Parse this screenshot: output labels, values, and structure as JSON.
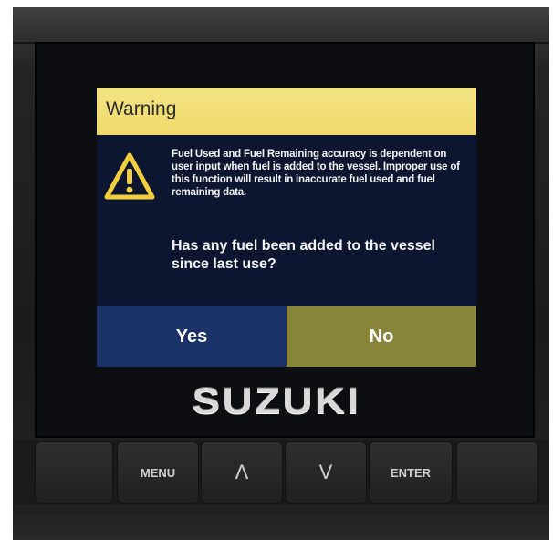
{
  "dialog": {
    "title": "Warning",
    "message": "Fuel Used and Fuel Remaining accuracy is dependent on user input when fuel is added to the vessel. Improper use of this function will result in inaccurate fuel used and fuel remaining data.",
    "question": "Has any fuel been added to the vessel since last use?",
    "yes_label": "Yes",
    "no_label": "No"
  },
  "brand": {
    "logo_text": "SUZUKI"
  },
  "keypad": {
    "menu_label": "MENU",
    "up_label": "Λ",
    "down_label": "V",
    "enter_label": "ENTER"
  },
  "colors": {
    "header_yellow": "#efd96a",
    "dialog_bg": "#0d1630",
    "yes_blue": "#1a3268",
    "no_olive": "#88843a"
  },
  "icons": [
    "warning-triangle-icon"
  ]
}
